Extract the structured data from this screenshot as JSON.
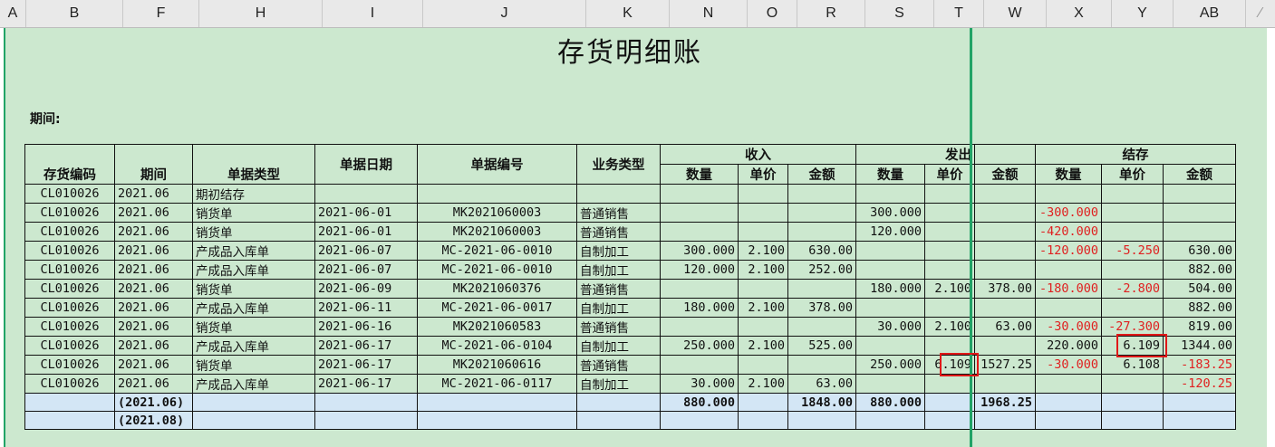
{
  "column_headers": [
    "A",
    "B",
    "F",
    "H",
    "I",
    "J",
    "K",
    "N",
    "O",
    "R",
    "S",
    "T",
    "W",
    "X",
    "Y",
    "AB"
  ],
  "report": {
    "title": "存货明细账",
    "period_label": "期间:"
  },
  "groups": {
    "income": "收入",
    "issue": "发出",
    "balance": "结存"
  },
  "headers": {
    "inv_code": "存货编码",
    "period": "期间",
    "doc_type": "单据类型",
    "doc_date": "单据日期",
    "doc_no": "单据编号",
    "biz_type": "业务类型",
    "in_qty": "数量",
    "in_price": "单价",
    "in_amt": "金额",
    "out_qty": "数量",
    "out_price": "单价",
    "out_amt": "金额",
    "bal_qty": "数量",
    "bal_price": "单价",
    "bal_amt": "金额"
  },
  "rows": [
    [
      "CL010026",
      "2021.06",
      "期初结存",
      "",
      "",
      "",
      "",
      "",
      "",
      "",
      "",
      "",
      "",
      "",
      ""
    ],
    [
      "CL010026",
      "2021.06",
      "销货单",
      "2021-06-01",
      "MK2021060003",
      "普通销售",
      "",
      "",
      "",
      "300.000",
      "",
      "",
      "-300.000",
      "",
      ""
    ],
    [
      "CL010026",
      "2021.06",
      "销货单",
      "2021-06-01",
      "MK2021060003",
      "普通销售",
      "",
      "",
      "",
      "120.000",
      "",
      "",
      "-420.000",
      "",
      ""
    ],
    [
      "CL010026",
      "2021.06",
      "产成品入库单",
      "2021-06-07",
      "MC-2021-06-0010",
      "自制加工",
      "300.000",
      "2.100",
      "630.00",
      "",
      "",
      "",
      "-120.000",
      "-5.250",
      "630.00"
    ],
    [
      "CL010026",
      "2021.06",
      "产成品入库单",
      "2021-06-07",
      "MC-2021-06-0010",
      "自制加工",
      "120.000",
      "2.100",
      "252.00",
      "",
      "",
      "",
      "",
      "",
      "882.00"
    ],
    [
      "CL010026",
      "2021.06",
      "销货单",
      "2021-06-09",
      "MK2021060376",
      "普通销售",
      "",
      "",
      "",
      "180.000",
      "2.100",
      "378.00",
      "-180.000",
      "-2.800",
      "504.00"
    ],
    [
      "CL010026",
      "2021.06",
      "产成品入库单",
      "2021-06-11",
      "MC-2021-06-0017",
      "自制加工",
      "180.000",
      "2.100",
      "378.00",
      "",
      "",
      "",
      "",
      "",
      "882.00"
    ],
    [
      "CL010026",
      "2021.06",
      "销货单",
      "2021-06-16",
      "MK2021060583",
      "普通销售",
      "",
      "",
      "",
      "30.000",
      "2.100",
      "63.00",
      "-30.000",
      "-27.300",
      "819.00"
    ],
    [
      "CL010026",
      "2021.06",
      "产成品入库单",
      "2021-06-17",
      "MC-2021-06-0104",
      "自制加工",
      "250.000",
      "2.100",
      "525.00",
      "",
      "",
      "",
      "220.000",
      "6.109",
      "1344.00"
    ],
    [
      "CL010026",
      "2021.06",
      "销货单",
      "2021-06-17",
      "MK2021060616",
      "普通销售",
      "",
      "",
      "",
      "250.000",
      "6.109",
      "1527.25",
      "-30.000",
      "6.108",
      "-183.25"
    ],
    [
      "CL010026",
      "2021.06",
      "产成品入库单",
      "2021-06-17",
      "MC-2021-06-0117",
      "自制加工",
      "30.000",
      "2.100",
      "63.00",
      "",
      "",
      "",
      "",
      "",
      "-120.25"
    ]
  ],
  "summary_rows": [
    [
      "",
      "(2021.06)",
      "",
      "",
      "",
      "",
      "880.000",
      "",
      "1848.00",
      "880.000",
      "",
      "1968.25",
      "",
      "",
      ""
    ],
    [
      "",
      "(2021.08)",
      "",
      "",
      "",
      "",
      "",
      "",
      "",
      "",
      "",
      "",
      "",
      "",
      ""
    ]
  ],
  "colors": {
    "sheet_bg": "#cce8cf",
    "summary_bg": "#d3e6f5",
    "negative": "#e02020",
    "highlight": "#e01818",
    "freeze_line": "#21a366"
  }
}
